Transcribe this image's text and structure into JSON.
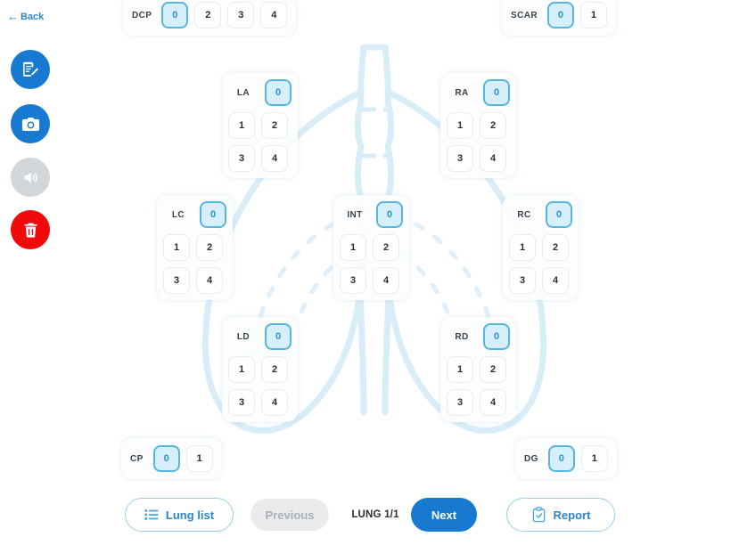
{
  "sidebar": {
    "back_label": "Back",
    "back_icon": "arrow-left-icon",
    "buttons": [
      {
        "name": "note-edit",
        "icon": "note-edit-icon",
        "color": "#1779d0",
        "enabled": true
      },
      {
        "name": "camera",
        "icon": "camera-icon",
        "color": "#1779d0",
        "enabled": true
      },
      {
        "name": "sound",
        "icon": "speaker-icon",
        "color": "#d3d6d9",
        "enabled": false
      },
      {
        "name": "delete",
        "icon": "trash-icon",
        "color": "#f00a0a",
        "enabled": true
      }
    ]
  },
  "panels": {
    "dcp": {
      "label": "DCP",
      "options": [
        "0",
        "2",
        "3",
        "4"
      ],
      "selected": "0"
    },
    "scar": {
      "label": "SCAR",
      "options": [
        "0",
        "1"
      ],
      "selected": "0"
    },
    "la": {
      "label": "LA",
      "options": [
        "0",
        "1",
        "2",
        "3",
        "4"
      ],
      "selected": "0"
    },
    "ra": {
      "label": "RA",
      "options": [
        "0",
        "1",
        "2",
        "3",
        "4"
      ],
      "selected": "0"
    },
    "lc": {
      "label": "LC",
      "options": [
        "0",
        "1",
        "2",
        "3",
        "4"
      ],
      "selected": "0"
    },
    "int": {
      "label": "INT",
      "options": [
        "0",
        "1",
        "2",
        "3",
        "4"
      ],
      "selected": "0"
    },
    "rc": {
      "label": "RC",
      "options": [
        "0",
        "1",
        "2",
        "3",
        "4"
      ],
      "selected": "0"
    },
    "ld": {
      "label": "LD",
      "options": [
        "0",
        "1",
        "2",
        "3",
        "4"
      ],
      "selected": "0"
    },
    "rd": {
      "label": "RD",
      "options": [
        "0",
        "1",
        "2",
        "3",
        "4"
      ],
      "selected": "0"
    },
    "cp": {
      "label": "CP",
      "options": [
        "0",
        "1"
      ],
      "selected": "0"
    },
    "dg": {
      "label": "DG",
      "options": [
        "0",
        "1"
      ],
      "selected": "0"
    }
  },
  "bottom_bar": {
    "lung_list_label": "Lung list",
    "lung_list_icon": "list-icon",
    "previous_label": "Previous",
    "page_indicator": "LUNG 1/1",
    "next_label": "Next",
    "report_label": "Report",
    "report_icon": "clipboard-check-icon"
  },
  "colors": {
    "accent_blue": "#1779d0",
    "link_blue": "#2e86c8",
    "selected_fill": "#d7effa",
    "selected_border": "#57b6dd",
    "selected_text": "#2a93c9",
    "danger_red": "#f00a0a",
    "disabled_gray": "#d3d6d9",
    "lung_outline": "#d5ebf7"
  }
}
